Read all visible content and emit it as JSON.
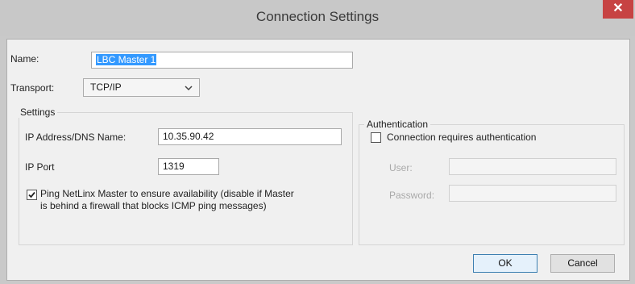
{
  "window": {
    "title": "Connection Settings",
    "close_label": "✕"
  },
  "name": {
    "label": "Name:",
    "value": "LBC Master 1"
  },
  "transport": {
    "label": "Transport:",
    "value": "TCP/IP"
  },
  "settings": {
    "title": "Settings",
    "ip_label": "IP Address/DNS Name:",
    "ip_value": "10.35.90.42",
    "port_label": "IP Port",
    "port_value": "1319",
    "ping_checked": true,
    "ping_line1": "Ping NetLinx Master to ensure availability (disable if Master",
    "ping_line2": "is behind a firewall that blocks ICMP ping messages)"
  },
  "auth": {
    "title": "Authentication",
    "requires_label": "Connection requires authentication",
    "requires_checked": false,
    "user_label": "User:",
    "user_value": "",
    "password_label": "Password:",
    "password_value": ""
  },
  "buttons": {
    "ok": "OK",
    "cancel": "Cancel"
  },
  "colors": {
    "close": "#c74343",
    "selection": "#3399ff",
    "titlebar": "#c8c8c8"
  }
}
